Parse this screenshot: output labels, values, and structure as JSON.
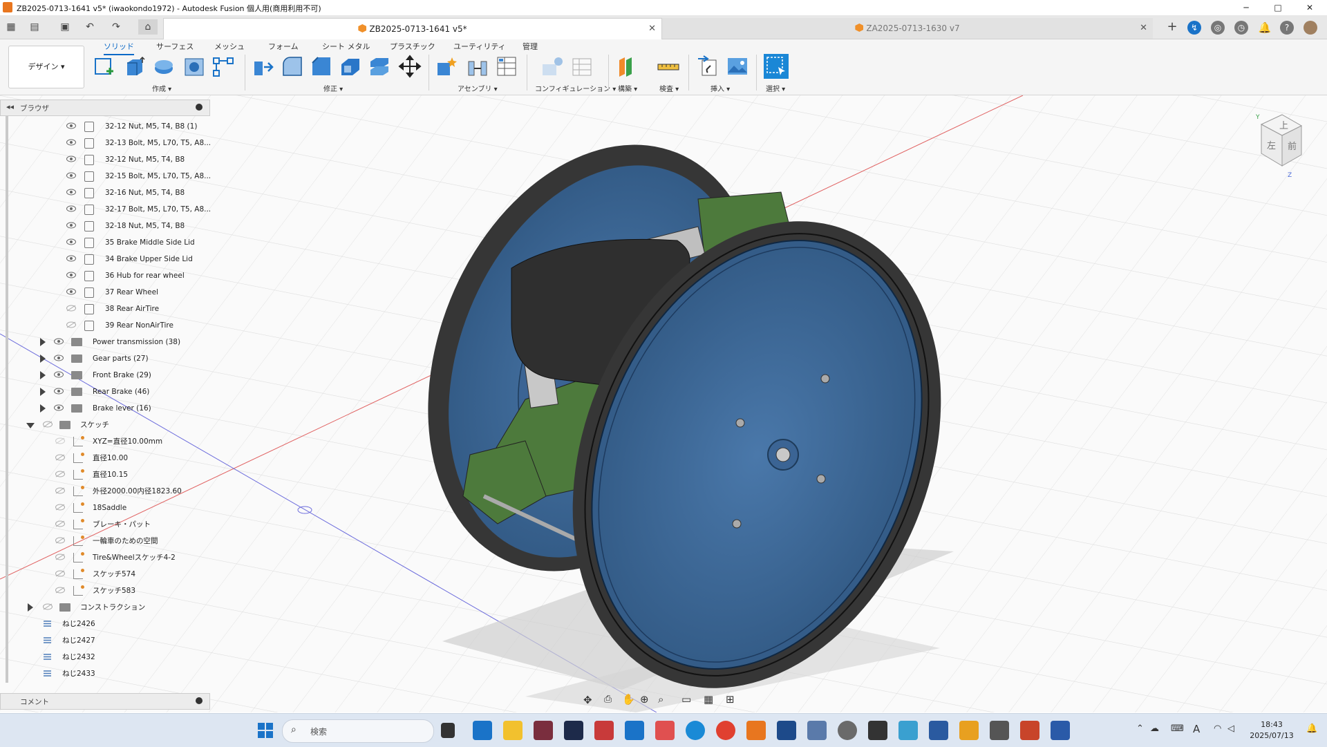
{
  "window": {
    "title": "ZB2025-0713-1641 v5* (iwaokondo1972) - Autodesk Fusion 個人用(商用利用不可)",
    "controls": [
      "─",
      "□",
      "✕"
    ]
  },
  "tabs": [
    {
      "label": "ZB2025-0713-1641 v5*",
      "active": true
    },
    {
      "label": "ZA2025-0713-1630 v7",
      "active": false
    }
  ],
  "ribbon": {
    "workspace": "デザイン ▾",
    "tabs": [
      "ソリッド",
      "サーフェス",
      "メッシュ",
      "フォーム",
      "シート メタル",
      "プラスチック",
      "ユーティリティ",
      "管理"
    ],
    "groups": [
      "作成 ▾",
      "修正 ▾",
      "アセンブリ ▾",
      "コンフィギュレーション ▾",
      "構築 ▾",
      "検査 ▾",
      "挿入 ▾",
      "選択 ▾"
    ]
  },
  "browser": {
    "title": "ブラウザ",
    "items": [
      {
        "label": "32-12 Nut, M5, T4, B8 (1)",
        "type": "body"
      },
      {
        "label": "32-13 Bolt, M5, L70, T5, A8...",
        "type": "body"
      },
      {
        "label": "32-12 Nut, M5, T4, B8",
        "type": "body"
      },
      {
        "label": "32-15 Bolt, M5, L70, T5, A8...",
        "type": "body"
      },
      {
        "label": "32-16 Nut, M5, T4, B8",
        "type": "body"
      },
      {
        "label": "32-17 Bolt, M5, L70, T5, A8...",
        "type": "body"
      },
      {
        "label": "32-18 Nut, M5, T4, B8",
        "type": "body"
      },
      {
        "label": "35 Brake Middle Side Lid",
        "type": "body"
      },
      {
        "label": "34 Brake Upper Side Lid",
        "type": "body"
      },
      {
        "label": "36 Hub for rear wheel",
        "type": "body"
      },
      {
        "label": "37 Rear Wheel",
        "type": "body"
      },
      {
        "label": "38 Rear AirTire",
        "type": "body"
      },
      {
        "label": "39 Rear NonAirTire",
        "type": "body"
      },
      {
        "label": "Power transmission (38)",
        "type": "folder"
      },
      {
        "label": "Gear parts (27)",
        "type": "folder"
      },
      {
        "label": "Front Brake (29)",
        "type": "folder"
      },
      {
        "label": "Rear Brake (46)",
        "type": "folder"
      },
      {
        "label": "Brake lever (16)",
        "type": "folder"
      },
      {
        "label": "スケッチ",
        "type": "folder-open"
      },
      {
        "label": "XYZ=直径10.00mm",
        "type": "sketch"
      },
      {
        "label": "直径10.00",
        "type": "sketch"
      },
      {
        "label": "直径10.15",
        "type": "sketch"
      },
      {
        "label": "外径2000.00内径1823.60",
        "type": "sketch"
      },
      {
        "label": "18Saddle",
        "type": "sketch"
      },
      {
        "label": "ブレーキ・パット",
        "type": "sketch"
      },
      {
        "label": "一輪車のための空間",
        "type": "sketch"
      },
      {
        "label": "Tire&Wheelスケッチ4-2",
        "type": "sketch"
      },
      {
        "label": "スケッチ574",
        "type": "sketch"
      },
      {
        "label": "スケッチ583",
        "type": "sketch"
      },
      {
        "label": "コンストラクション",
        "type": "folder"
      },
      {
        "label": "ねじ2426",
        "type": "thread"
      },
      {
        "label": "ねじ2427",
        "type": "thread"
      },
      {
        "label": "ねじ2432",
        "type": "thread"
      },
      {
        "label": "ねじ2433",
        "type": "thread"
      }
    ]
  },
  "comments": {
    "title": "コメント"
  },
  "viewcube": {
    "top": "上",
    "left": "左",
    "front": "前",
    "axis_y": "Y",
    "axis_z": "Z"
  },
  "taskbar": {
    "search_placeholder": "検索",
    "time": "18:43",
    "date": "2025/07/13",
    "ime": "A"
  },
  "colors": {
    "accent": "#0b69c7",
    "rim": "#3b6494",
    "tire": "#3a3a3a",
    "green": "#4d7a3c"
  }
}
